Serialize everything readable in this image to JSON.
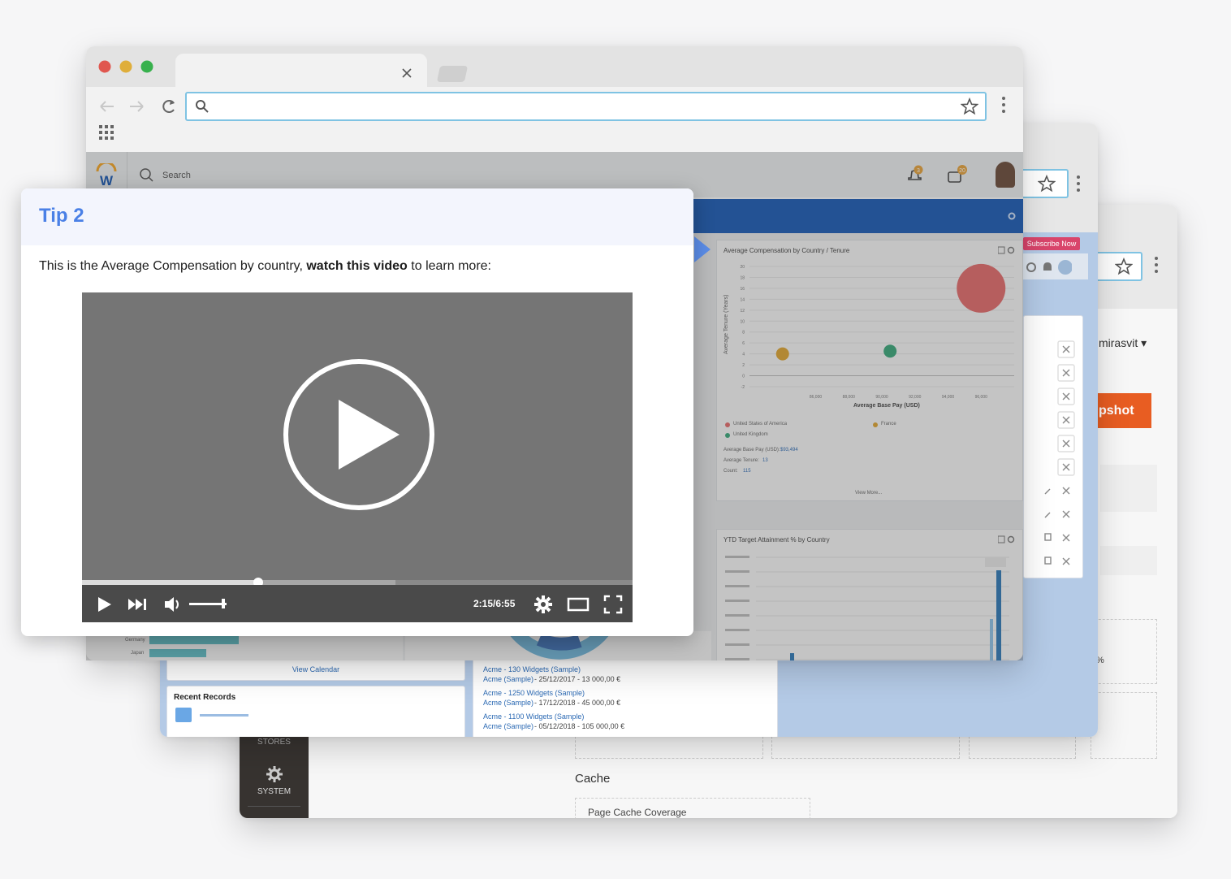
{
  "tip": {
    "title": "Tip 2",
    "text_before": "This is the Average Compensation by country, ",
    "text_bold": "watch this video",
    "text_after": " to learn more:",
    "video": {
      "time": "2:15/6:55",
      "progress": 0.32,
      "buffered": 0.57
    }
  },
  "workday": {
    "search_placeholder": "Search",
    "bell_badge": "3",
    "inbox_badge": "20",
    "chart1": {
      "title": "Average Compensation by Country / Tenure",
      "ylabel": "Average Tenure (Years)",
      "xlabel": "Average Base Pay (USD)",
      "legend": [
        "United States of America",
        "France",
        "United Kingdom"
      ],
      "stats": [
        {
          "label": "Average Base Pay (USD):",
          "value": "$93,494"
        },
        {
          "label": "Average Tenure:",
          "value": "13"
        },
        {
          "label": "Count:",
          "value": "115"
        }
      ],
      "view_more": "View More..."
    },
    "chart2": {
      "title": "YTD Target Attainment % by Country"
    },
    "side_rows": [
      "Germany",
      "Japan"
    ]
  },
  "chart_data": {
    "type": "scatter",
    "title": "Average Compensation by Country / Tenure",
    "xlabel": "Average Base Pay (USD)",
    "ylabel": "Average Tenure (Years)",
    "x_ticks": [
      "86,000",
      "88,000",
      "90,000",
      "92,000",
      "94,000",
      "96,000"
    ],
    "y_ticks": [
      "20",
      "18",
      "16",
      "14",
      "12",
      "10",
      "8",
      "6",
      "4",
      "2",
      "0",
      "-2"
    ],
    "series": [
      {
        "name": "United States of America",
        "x": 96000,
        "y": 16,
        "color": "#e56b6b"
      },
      {
        "name": "France",
        "x": 84000,
        "y": 4,
        "color": "#e0a531"
      },
      {
        "name": "United Kingdom",
        "x": 90500,
        "y": 4.5,
        "color": "#3aa87a"
      }
    ]
  },
  "salesforce": {
    "view_calendar": "View Calendar",
    "recent_records": "Recent Records",
    "subscribe": "Subscribe Now",
    "records": [
      {
        "link": "Acme - 130 Widgets (Sample)",
        "sub": "Acme (Sample)",
        "detail": "- 25/12/2017 - 13 000,00 €"
      },
      {
        "link": "Acme - 1250 Widgets (Sample)",
        "sub": "Acme (Sample)",
        "detail": "- 17/12/2018 - 45 000,00 €"
      },
      {
        "link": "Acme - 1100 Widgets (Sample)",
        "sub": "Acme (Sample)",
        "detail": "- 05/12/2018 - 105 000,00 €"
      }
    ]
  },
  "magento": {
    "user": "mirasvit",
    "snapshot_btn": "pshot",
    "percent": "%",
    "cache_title": "Cache",
    "page_cache": "Page Cache Coverage",
    "stores_label": "STORES",
    "system_label": "SYSTEM"
  },
  "colors": {
    "accent": "#4a80e6",
    "workday_blue": "#1a5bb6",
    "magento_orange": "#e85d22"
  }
}
